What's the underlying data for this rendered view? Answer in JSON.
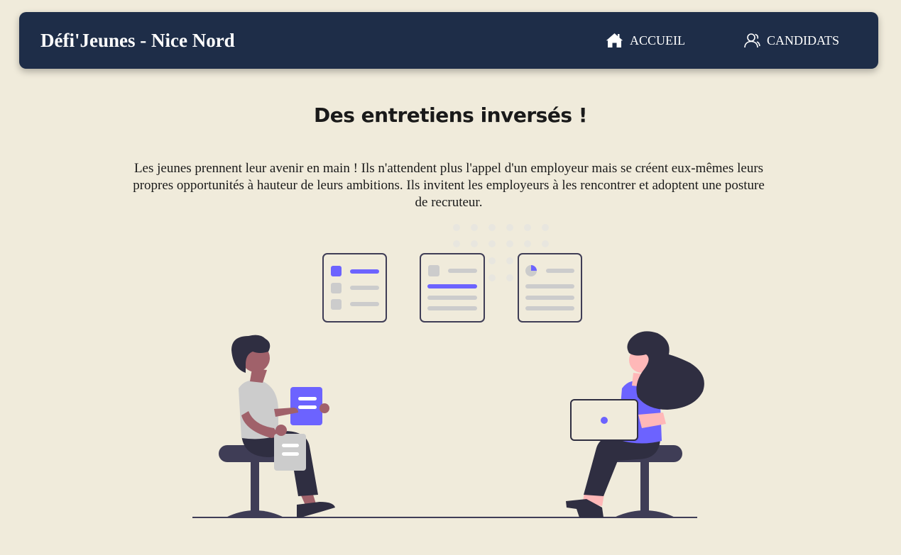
{
  "header": {
    "brand": "Défi'Jeunes - Nice Nord",
    "nav": {
      "home_label": "ACCUEIL",
      "candidats_label": "CANDIDATS"
    }
  },
  "hero": {
    "title": "Des entretiens inversés !",
    "description": "Les jeunes prennent leur avenir en main ! Ils n'attendent plus l'appel d'un employeur mais se créent eux-mêmes leurs propres opportunités à hauteur de leurs ambitions. Ils invitent les employeurs à les rencontrer et adoptent une posture de recruteur."
  },
  "icons": {
    "home": "home-icon",
    "candidats": "users-icon"
  },
  "colors": {
    "navbar": "#1e2d48",
    "background": "#f0ebdb",
    "accent": "#6c63ff",
    "dark": "#2f2e41",
    "neutral": "#cccccc"
  }
}
